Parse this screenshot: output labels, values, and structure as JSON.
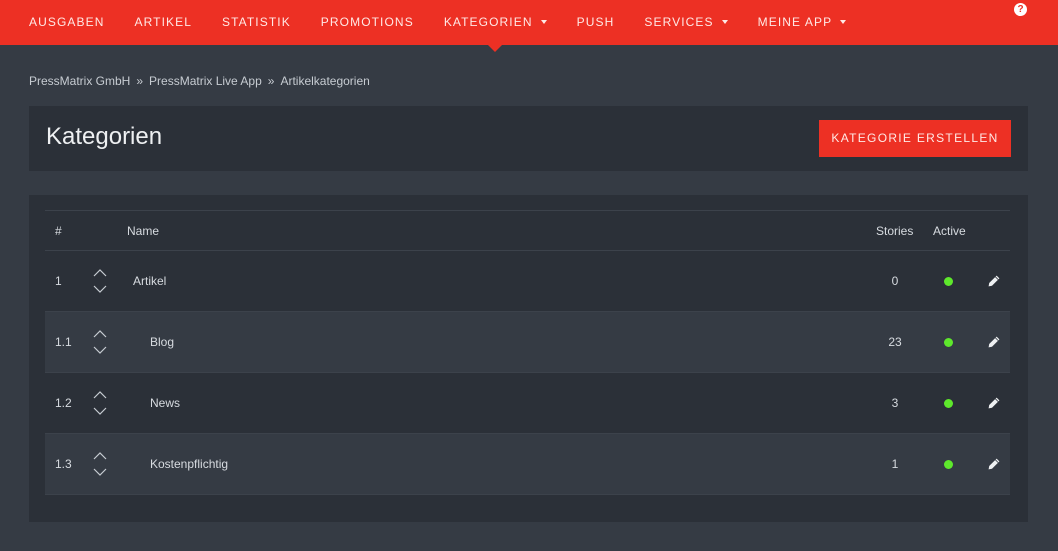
{
  "nav": {
    "items": [
      {
        "label": "AUSGABEN",
        "dropdown": false,
        "active": false
      },
      {
        "label": "ARTIKEL",
        "dropdown": false,
        "active": false
      },
      {
        "label": "STATISTIK",
        "dropdown": false,
        "active": false
      },
      {
        "label": "PROMOTIONS",
        "dropdown": false,
        "active": false
      },
      {
        "label": "KATEGORIEN",
        "dropdown": true,
        "active": true
      },
      {
        "label": "PUSH",
        "dropdown": false,
        "active": false
      },
      {
        "label": "SERVICES",
        "dropdown": true,
        "active": false
      },
      {
        "label": "MEINE APP",
        "dropdown": true,
        "active": false
      }
    ],
    "help_glyph": "?"
  },
  "breadcrumb": {
    "items": [
      "PressMatrix GmbH",
      "PressMatrix Live App",
      "Artikelkategorien"
    ],
    "separator": "»"
  },
  "header": {
    "title": "Kategorien",
    "create_button": "KATEGORIE ERSTELLEN"
  },
  "table": {
    "headers": {
      "num": "#",
      "name": "Name",
      "stories": "Stories",
      "active": "Active"
    },
    "rows": [
      {
        "num": "1",
        "name": "Artikel",
        "level": 0,
        "stories": "0",
        "active": true
      },
      {
        "num": "1.1",
        "name": "Blog",
        "level": 1,
        "stories": "23",
        "active": true
      },
      {
        "num": "1.2",
        "name": "News",
        "level": 1,
        "stories": "3",
        "active": true
      },
      {
        "num": "1.3",
        "name": "Kostenpflichtig",
        "level": 1,
        "stories": "1",
        "active": true
      }
    ]
  },
  "colors": {
    "brand": "#ed3024",
    "active_dot": "#5ee82c",
    "background": "#353b44",
    "panel": "#2b3038"
  },
  "icons": {
    "sort_up": "chevron-up-icon",
    "sort_down": "chevron-down-icon",
    "edit": "pencil-icon",
    "help": "question-circle-icon",
    "status": "status-dot-icon"
  }
}
